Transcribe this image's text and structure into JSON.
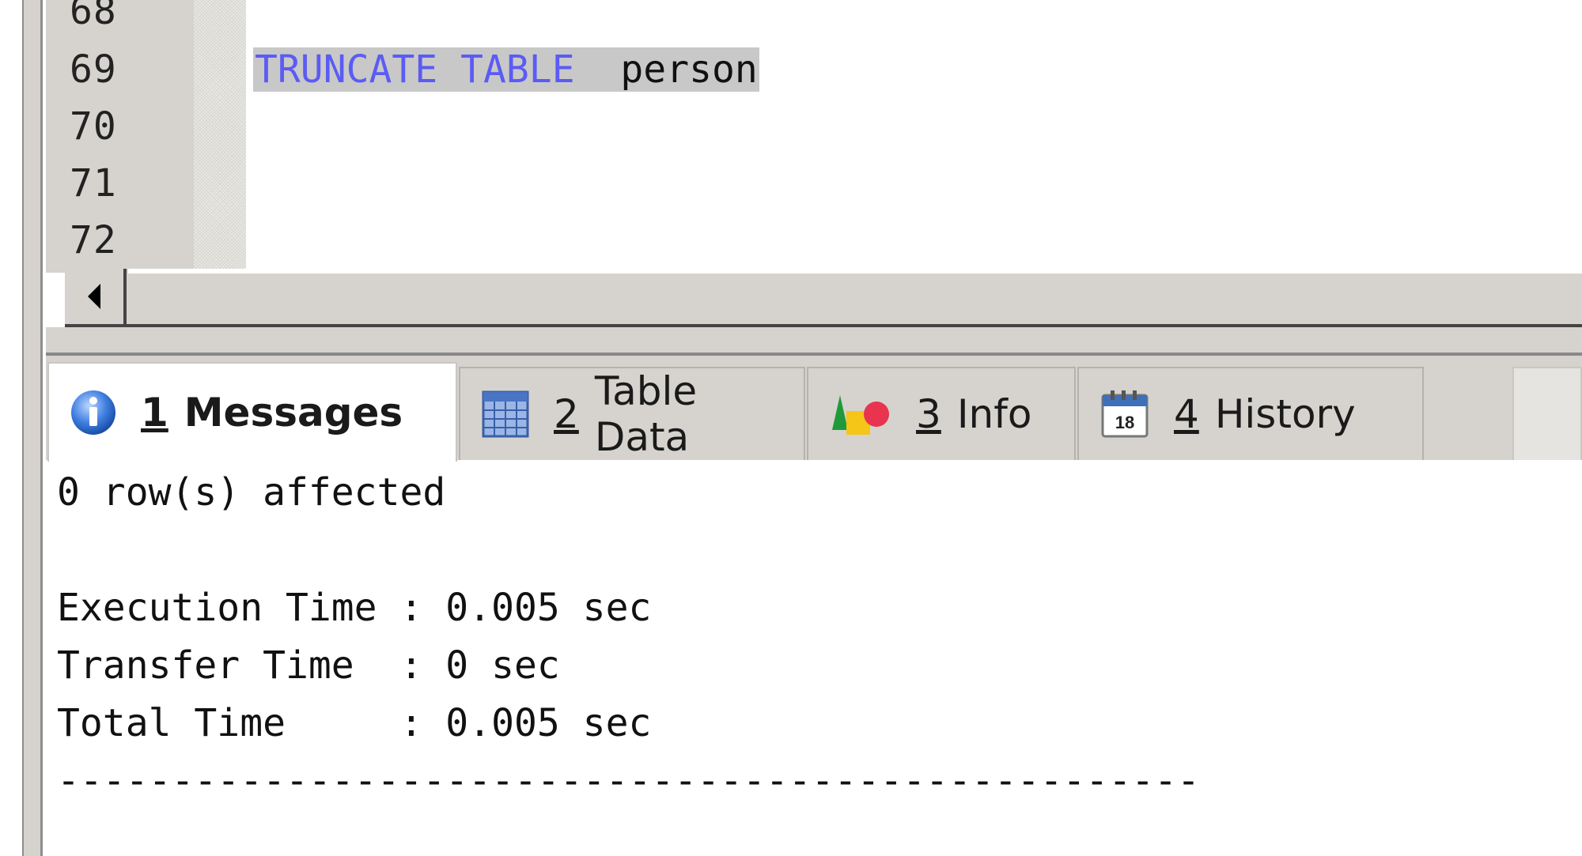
{
  "editor": {
    "lines": [
      {
        "num": "68",
        "code": ""
      },
      {
        "num": "69",
        "kw1": "TRUNCATE",
        "kw2": "TABLE",
        "ident": "person"
      },
      {
        "num": "70",
        "code": ""
      },
      {
        "num": "71",
        "code": ""
      },
      {
        "num": "72",
        "code": ""
      }
    ]
  },
  "tabs": [
    {
      "num": "1",
      "label": "Messages",
      "icon": "info-icon"
    },
    {
      "num": "2",
      "label": "Table Data",
      "icon": "table-grid-icon"
    },
    {
      "num": "3",
      "label": "Info",
      "icon": "shapes-icon"
    },
    {
      "num": "4",
      "label": "History",
      "icon": "calendar-icon"
    }
  ],
  "calendar_day": "18",
  "messages": {
    "affected": "0 row(s) affected",
    "execution": "Execution Time : 0.005 sec",
    "transfer": "Transfer Time  : 0 sec",
    "total": "Total Time     : 0.005 sec",
    "separator": "--------------------------------------------------"
  },
  "colors": {
    "keyword": "#5b5bf5",
    "selection": "#c8c8c8",
    "chrome": "#d6d3ce"
  }
}
